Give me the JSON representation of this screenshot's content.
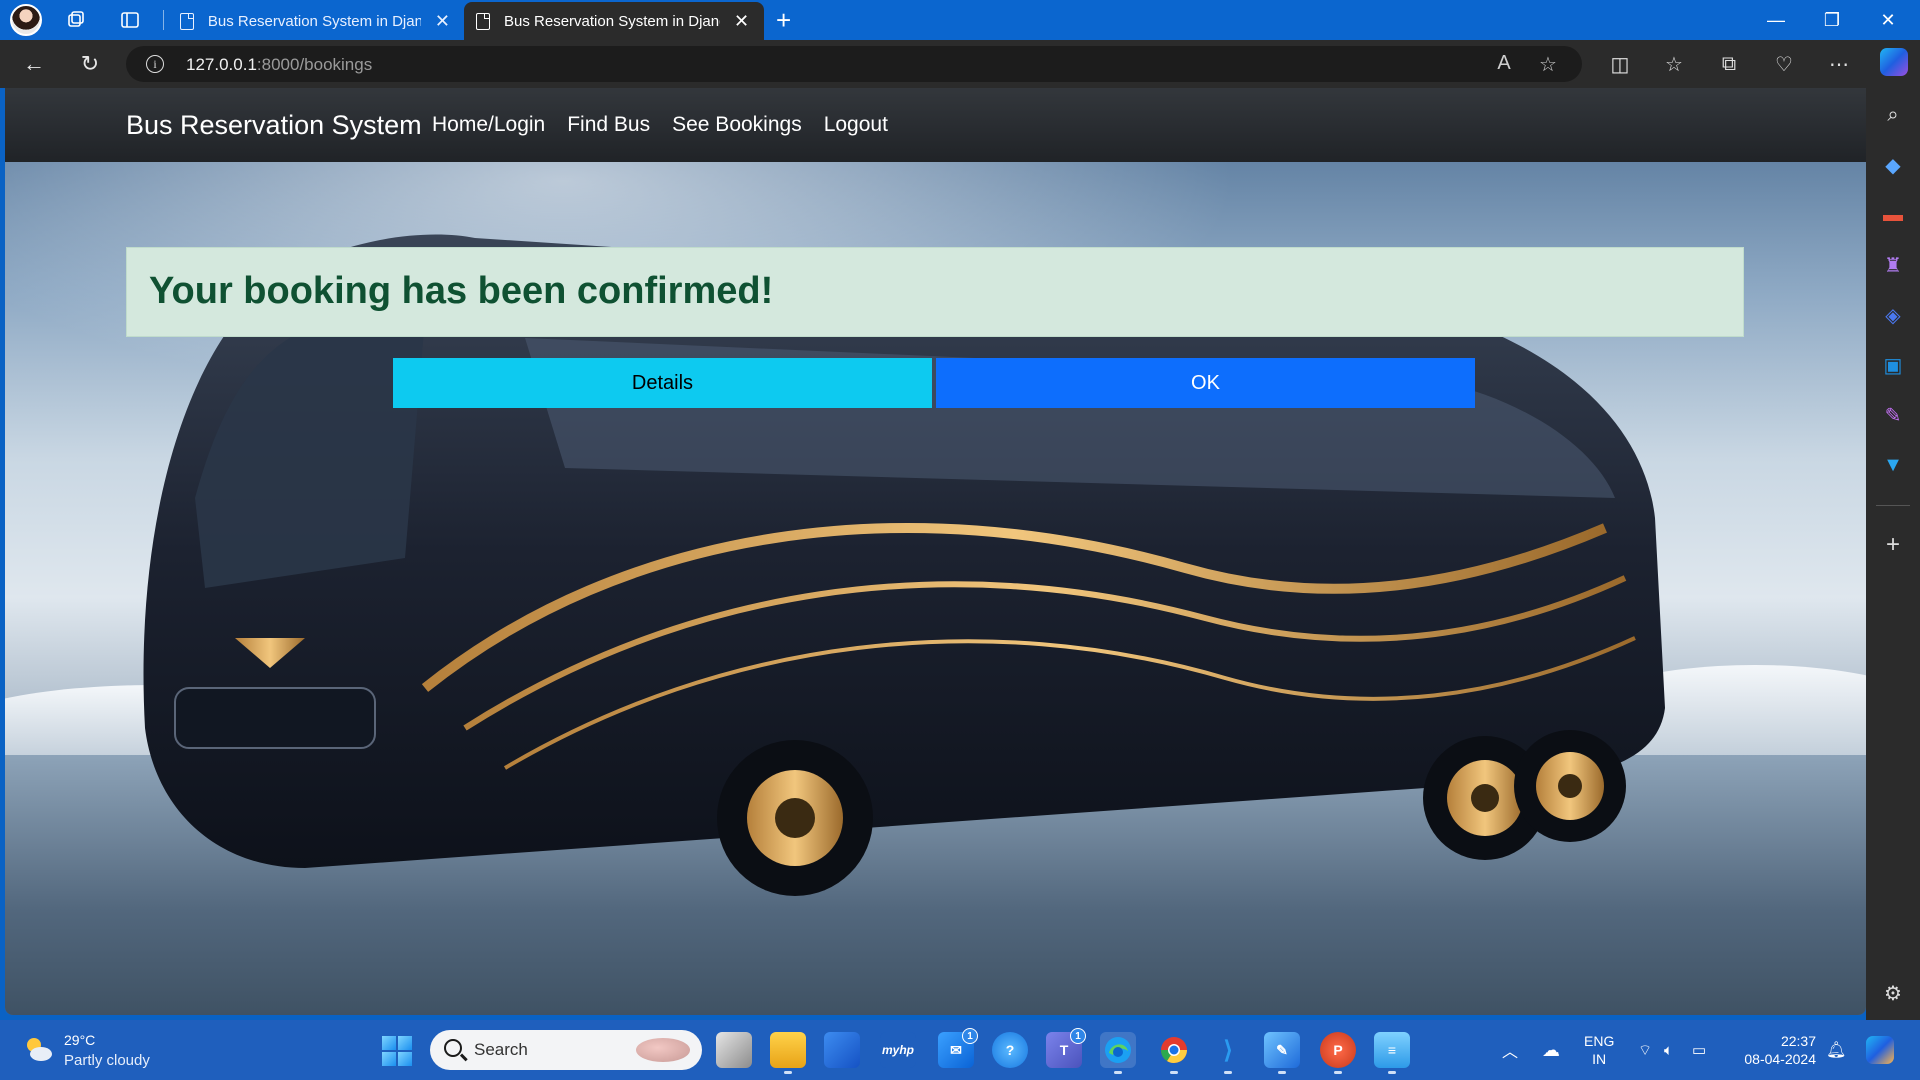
{
  "browser": {
    "tabs": [
      {
        "title": "Bus Reservation System in Djang"
      },
      {
        "title": "Bus Reservation System in Djang"
      }
    ],
    "url_host": "127.0.0.1",
    "url_path": ":8000/bookings"
  },
  "site": {
    "brand": "Bus Reservation System",
    "nav": [
      "Home/Login",
      "Find Bus",
      "See Bookings",
      "Logout"
    ],
    "alert": "Your booking has been confirmed!",
    "buttons": {
      "details": "Details",
      "ok": "OK"
    }
  },
  "taskbar": {
    "weather_temp": "29°C",
    "weather_desc": "Partly cloudy",
    "search_label": "Search",
    "lang_1": "ENG",
    "lang_2": "IN",
    "time": "22:37",
    "date": "08-04-2024",
    "badges": {
      "mail": "1",
      "teams": "1"
    }
  },
  "colors": {
    "details_button": "#0dcaf0",
    "ok_button": "#0d6efd",
    "alert_bg": "#d4e8dd",
    "alert_text": "#0f5132"
  }
}
